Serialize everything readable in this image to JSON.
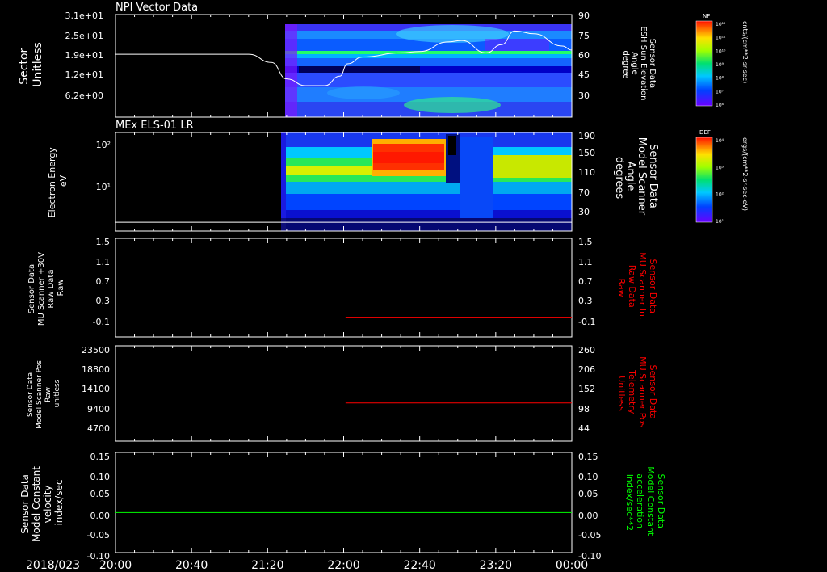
{
  "date_label": "2018/023",
  "time_axis": {
    "start_minutes": 1200,
    "end_minutes": 1440,
    "tick_labels": [
      "20:00",
      "20:40",
      "21:20",
      "22:00",
      "22:40",
      "23:20",
      "00:00"
    ]
  },
  "panels": [
    {
      "id": "npi",
      "title": "NPI Vector Data",
      "type": "heatmap",
      "left_label": [
        "Sector",
        "Unitless"
      ],
      "left_ticks": [
        "3.1e+01",
        "2.5e+01",
        "1.9e+01",
        "1.2e+01",
        "6.2e+00"
      ],
      "right_label": [
        "Sensor Data",
        "ESH Sun Elevation",
        "Angle",
        "degree"
      ],
      "right_ticks": [
        "90",
        "75",
        "60",
        "45",
        "30"
      ],
      "right_range": [
        15,
        90
      ]
    },
    {
      "id": "els",
      "title": "MEx ELS-01 LR",
      "type": "heatmap",
      "left_label": [
        "Electron Energy",
        "eV"
      ],
      "left_ticks": [
        "10²",
        "10¹"
      ],
      "right_label": [
        "Sensor Data",
        "Model Scanner",
        "Angle",
        "degrees"
      ],
      "right_ticks": [
        "190",
        "150",
        "110",
        "70",
        "30"
      ],
      "right_range": [
        0,
        190
      ]
    },
    {
      "id": "mu_int",
      "type": "line",
      "left_label": [
        "Sensor Data",
        "MU Scanner +30V",
        "Raw Data",
        "Raw"
      ],
      "left_ticks": [
        "1.5",
        "1.1",
        "0.7",
        "0.3",
        "-0.1"
      ],
      "right_label": [
        "Sensor Data",
        "MU Scanner Int",
        "Raw Data",
        "Raw"
      ],
      "right_ticks": [
        "1.5",
        "1.1",
        "0.7",
        "0.3",
        "-0.1"
      ],
      "range": [
        -0.5,
        1.5
      ],
      "line_color": "#ff0000"
    },
    {
      "id": "mu_pos",
      "type": "line",
      "left_label": [
        "Sensor Data",
        "Model Scanner Pos",
        "Raw",
        "unitless"
      ],
      "left_ticks": [
        "23500",
        "18800",
        "14100",
        "9400",
        "4700"
      ],
      "right_label": [
        "Sensor Data",
        "MU Scanner Pos",
        "Telemetry",
        "Unitless"
      ],
      "right_ticks": [
        "260",
        "206",
        "152",
        "98",
        "44"
      ],
      "range": [
        -10,
        260
      ],
      "line_color": "#ff0000"
    },
    {
      "id": "model_const",
      "type": "line",
      "left_label": [
        "Sensor Data",
        "Model Constant",
        "velocity",
        "index/sec"
      ],
      "left_ticks": [
        "0.15",
        "0.10",
        "0.05",
        "0.00",
        "-0.05",
        "-0.10"
      ],
      "right_label": [
        "Sensor Data",
        "Model Constant",
        "acceleration",
        "index/sec**2"
      ],
      "right_ticks": [
        "0.15",
        "0.10",
        "0.05",
        "0.00",
        "-0.05",
        "-0.10"
      ],
      "range": [
        -0.1,
        0.15
      ],
      "line_color": "#00ff00"
    }
  ],
  "colorbars": [
    {
      "label": "NF",
      "units": "cnts/(cm**2-sr-sec)",
      "tick_labels": [
        "10¹²",
        "10¹¹",
        "10¹⁰",
        "10⁹",
        "10⁸",
        "10⁷",
        "10⁶"
      ]
    },
    {
      "label": "DEF",
      "units": "ergs/(cm**2-sr-sec-eV)",
      "tick_labels": [
        "10⁴",
        "10³",
        "10²",
        "10¹"
      ]
    }
  ],
  "chart_data": [
    {
      "type": "heatmap",
      "title": "NPI Vector Data",
      "xlabel": "",
      "ylabel": "Sector Unitless",
      "x_range": [
        "20:00",
        "00:00"
      ],
      "data_start": "21:24",
      "overlay": {
        "name": "Sensor Data ESH Sun Elevation Angle",
        "units": "degree",
        "x_minutes": [
          1200,
          1270,
          1282,
          1290,
          1300,
          1310,
          1318,
          1322,
          1330,
          1350,
          1360,
          1375,
          1382,
          1395,
          1403,
          1410,
          1420,
          1435,
          1440
        ],
        "y": [
          61,
          61,
          55,
          43,
          38,
          38,
          45,
          54,
          59,
          62,
          63,
          70,
          71,
          62,
          68,
          78,
          76,
          67,
          64
        ]
      }
    },
    {
      "type": "heatmap",
      "title": "MEx ELS-01 LR",
      "ylabel": "Electron Energy eV",
      "y_scale": "log",
      "data_start": "21:23",
      "overlay": {
        "name": "Sensor Data Model Scanner Angle",
        "units": "degrees",
        "x_minutes": [
          1200,
          1440
        ],
        "y": [
          3,
          3
        ]
      }
    },
    {
      "type": "line",
      "series": [
        {
          "name": "Sensor Data MU Scanner Int Raw Data",
          "x_minutes": [
            1321,
            1440
          ],
          "y": [
            -0.1,
            -0.1
          ]
        }
      ],
      "ylim": [
        -0.5,
        1.5
      ]
    },
    {
      "type": "line",
      "series": [
        {
          "name": "Sensor Data MU Scanner Pos Telemetry",
          "x_minutes": [
            1321,
            1440
          ],
          "y": [
            98,
            98
          ]
        }
      ],
      "ylim": [
        -10,
        260
      ]
    },
    {
      "type": "line",
      "series": [
        {
          "name": "Sensor Data Model Constant",
          "x_minutes": [
            1200,
            1440
          ],
          "y": [
            0.0,
            0.0
          ]
        }
      ],
      "ylim": [
        -0.1,
        0.15
      ]
    }
  ]
}
